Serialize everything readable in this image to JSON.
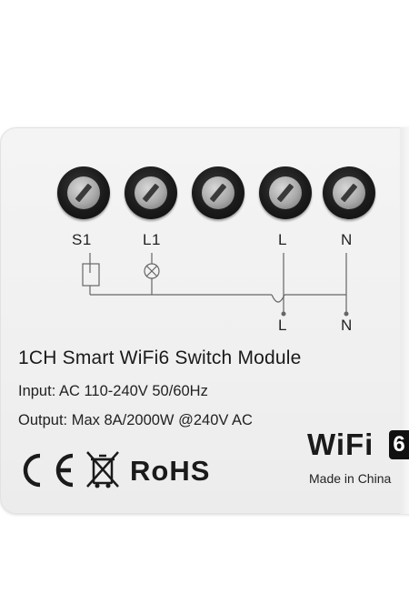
{
  "terminals": {
    "labels": [
      "S1",
      "L1",
      "L",
      "N"
    ],
    "bottom_labels": [
      "L",
      "N"
    ]
  },
  "product": {
    "title": "1CH Smart WiFi6 Switch Module",
    "input": "Input: AC 110-240V 50/60Hz",
    "output": "Output: Max 8A/2000W @240V AC"
  },
  "certifications": {
    "ce": "CE",
    "rohs": "RoHS"
  },
  "branding": {
    "wifi_text": "WiFi",
    "wifi_version": "6",
    "origin": "Made in China"
  }
}
